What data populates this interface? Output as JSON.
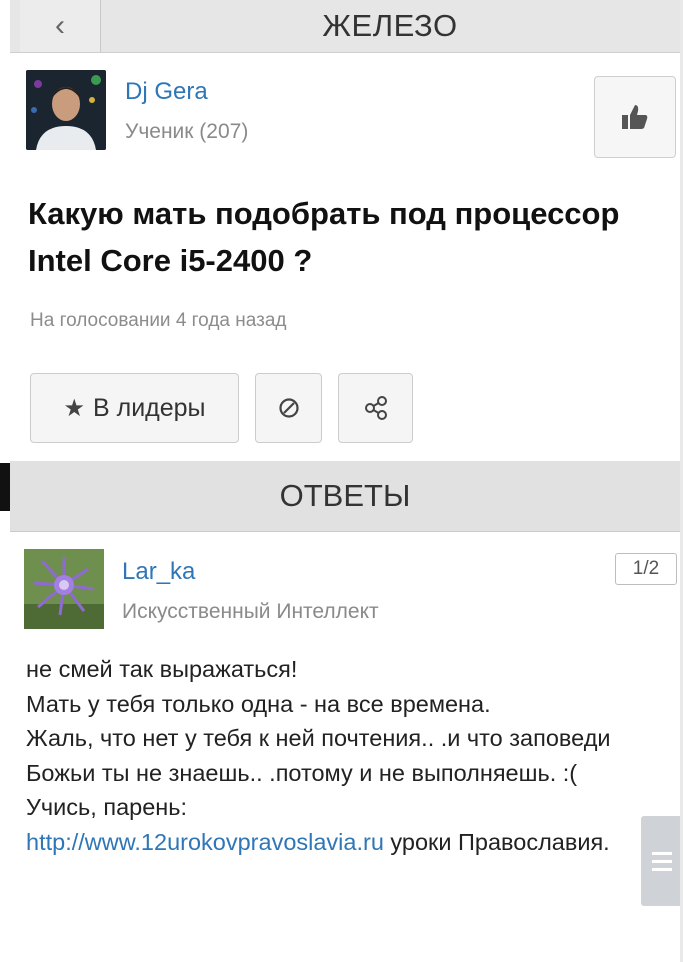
{
  "header": {
    "back_icon": "chevron-left-icon",
    "title": "ЖЕЛЕЗО"
  },
  "question": {
    "author": {
      "name": "Dj Gera",
      "rank": "Ученик (207)"
    },
    "like_icon": "thumbs-up-icon",
    "title": "Какую мать подобрать под процессор Intel Core i5-2400 ?",
    "status": "На голосовании 4 года назад",
    "actions": {
      "leaders_label": "В лидеры",
      "leaders_icon": "star-icon",
      "block_icon": "block-icon",
      "share_icon": "share-icon"
    }
  },
  "answers": {
    "header": "ОТВЕТЫ",
    "items": [
      {
        "author": {
          "name": "Lar_ka",
          "rank": "Искусственный Интеллект"
        },
        "counter": "1/2",
        "lines": [
          "не смей так выражаться!",
          "Мать у тебя только одна - на все времена.",
          "Жаль, что нет у тебя к ней почтения.. .и что заповеди Божьи ты не знаешь.. .потому и не выполняешь. :(",
          "Учись, парень:"
        ],
        "link": "http://www.12urokovpravoslavia.ru",
        "after_link": " уроки Православия."
      }
    ]
  },
  "menu_icon": "menu-icon",
  "colors": {
    "link": "#2f76b6",
    "header_bg": "#e6e6e6"
  }
}
